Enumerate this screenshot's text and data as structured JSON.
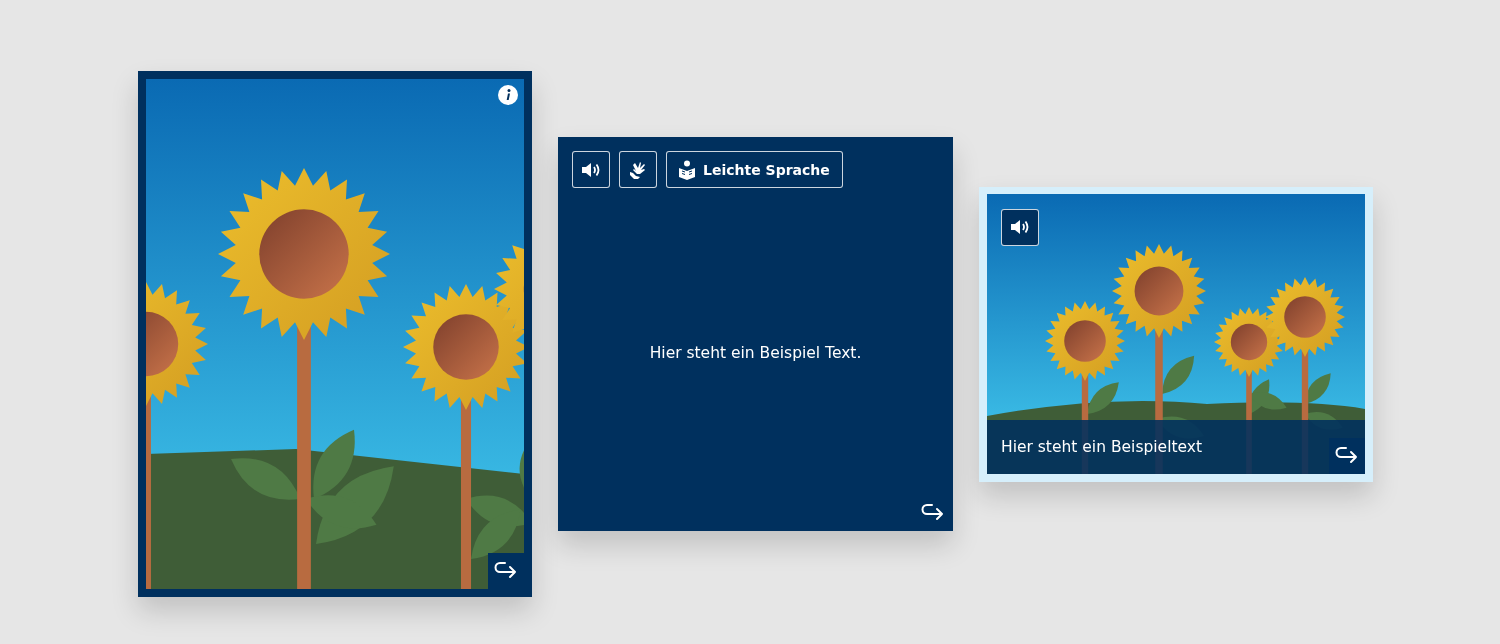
{
  "cards": [
    {
      "kind": "image",
      "highlighted": false
    },
    {
      "kind": "text",
      "buttons": [
        {
          "kind": "audio"
        },
        {
          "kind": "sign-language"
        },
        {
          "kind": "easy-language",
          "label": "Leichte Sprache"
        }
      ],
      "text": "Hier steht ein Beispiel Text."
    },
    {
      "kind": "image-caption",
      "highlighted": true,
      "buttons": [
        {
          "kind": "audio"
        }
      ],
      "caption": "Hier steht ein Beispieltext"
    }
  ]
}
